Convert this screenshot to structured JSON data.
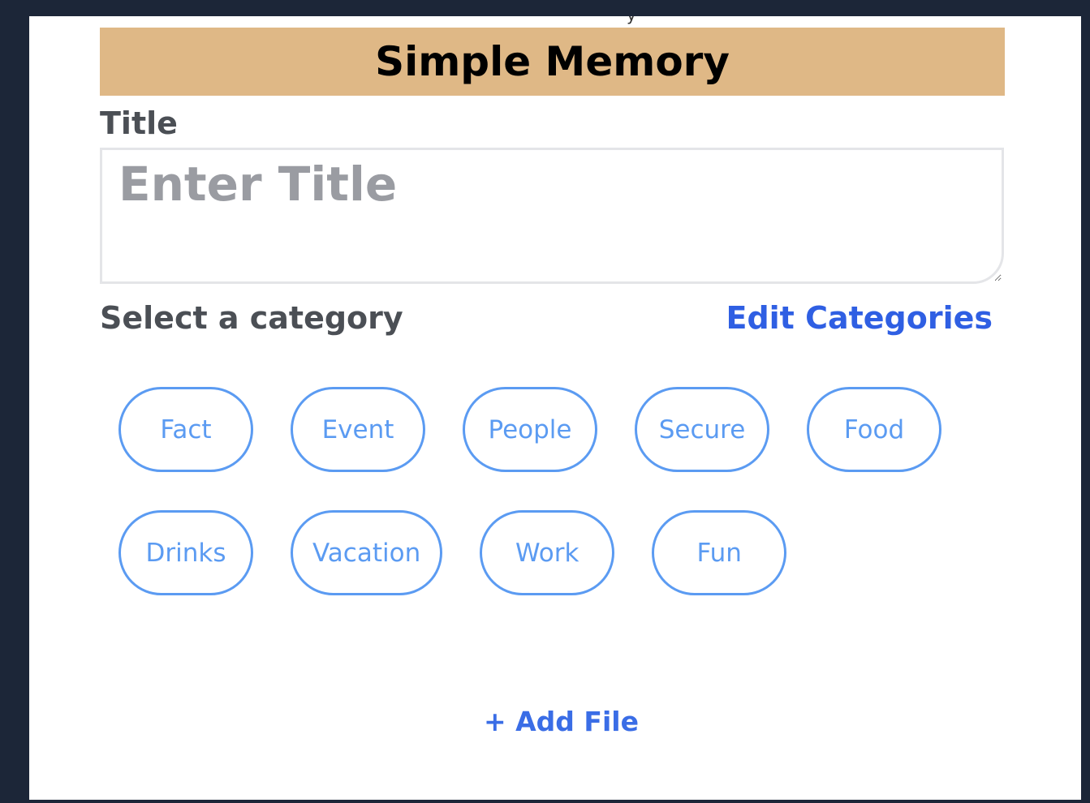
{
  "partial_text_above": "y",
  "header": {
    "title": "Simple Memory"
  },
  "title_field": {
    "label": "Title",
    "placeholder": "Enter Title",
    "value": ""
  },
  "category_section": {
    "label": "Select a category",
    "edit_link": "Edit Categories"
  },
  "categories": [
    {
      "label": "Fact"
    },
    {
      "label": "Event"
    },
    {
      "label": "People"
    },
    {
      "label": "Secure"
    },
    {
      "label": "Food"
    },
    {
      "label": "Drinks"
    },
    {
      "label": "Vacation"
    },
    {
      "label": "Work"
    },
    {
      "label": "Fun"
    }
  ],
  "actions": {
    "add_file": "+ Add File"
  },
  "colors": {
    "header_bg": "#dfb886",
    "chip_border": "#5b9bf2",
    "link": "#2f5fe3",
    "page_bg": "#1c2638"
  }
}
